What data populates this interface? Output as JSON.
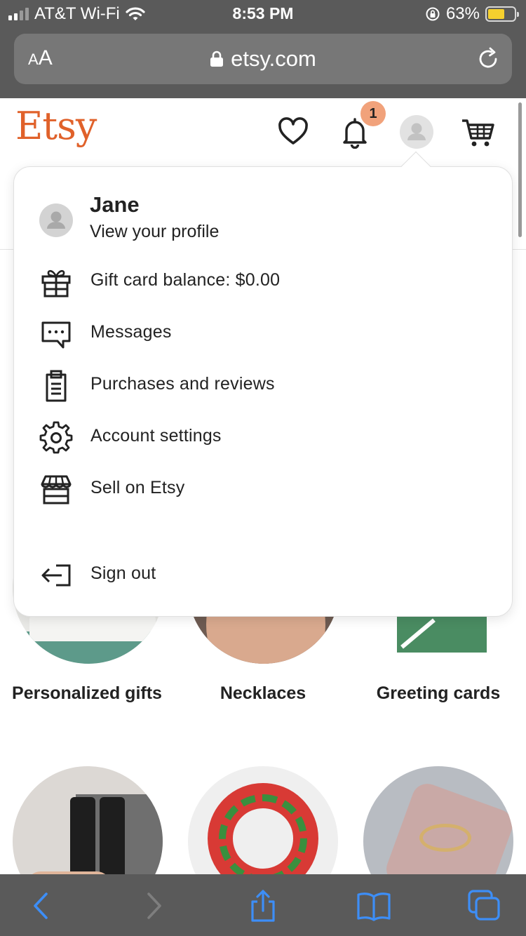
{
  "status_bar": {
    "carrier": "AT&T Wi-Fi",
    "time": "8:53 PM",
    "battery_percent": "63%",
    "battery_level": 0.63,
    "battery_color": "#f5d02e"
  },
  "browser": {
    "text_size_label": "AA",
    "url": "etsy.com"
  },
  "header": {
    "logo": "Etsy",
    "logo_color": "#e0612a",
    "notification_count": "1",
    "icons": [
      "heart-icon",
      "bell-icon",
      "avatar",
      "cart-icon"
    ]
  },
  "menu": {
    "name": "Jane",
    "view_profile": "View your profile",
    "items": [
      {
        "label": "Gift card balance: $0.00",
        "icon": "gift-icon"
      },
      {
        "label": "Messages",
        "icon": "message-icon"
      },
      {
        "label": "Purchases and reviews",
        "icon": "clipboard-icon"
      },
      {
        "label": "Account settings",
        "icon": "gear-icon"
      },
      {
        "label": "Sell on Etsy",
        "icon": "shop-icon"
      }
    ],
    "sign_out": {
      "label": "Sign out",
      "icon": "sign-out-icon"
    }
  },
  "categories": [
    {
      "label": "Personalized gifts"
    },
    {
      "label": "Necklaces"
    },
    {
      "label": "Greeting cards"
    }
  ],
  "toolbar": {
    "icons": [
      "back-icon",
      "forward-icon",
      "share-icon",
      "bookmarks-icon",
      "tabs-icon"
    ],
    "accent": "#3d8ef7"
  }
}
